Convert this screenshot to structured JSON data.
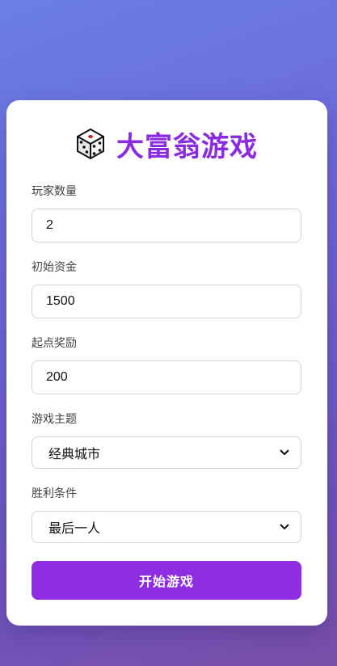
{
  "app": {
    "title": "大富翁游戏",
    "title_color": "#8a2be2",
    "title_icon": "dice-icon"
  },
  "form": {
    "player_count": {
      "label": "玩家数量",
      "value": "2"
    },
    "initial_funds": {
      "label": "初始资金",
      "value": "1500"
    },
    "start_bonus": {
      "label": "起点奖励",
      "value": "200"
    },
    "theme": {
      "label": "游戏主题",
      "selected": "经典城市",
      "icon": "chevron-down-icon"
    },
    "win_condition": {
      "label": "胜利条件",
      "selected": "最后一人",
      "icon": "chevron-down-icon"
    }
  },
  "start_button": {
    "label": "开始游戏",
    "color": "#8e2de2"
  }
}
